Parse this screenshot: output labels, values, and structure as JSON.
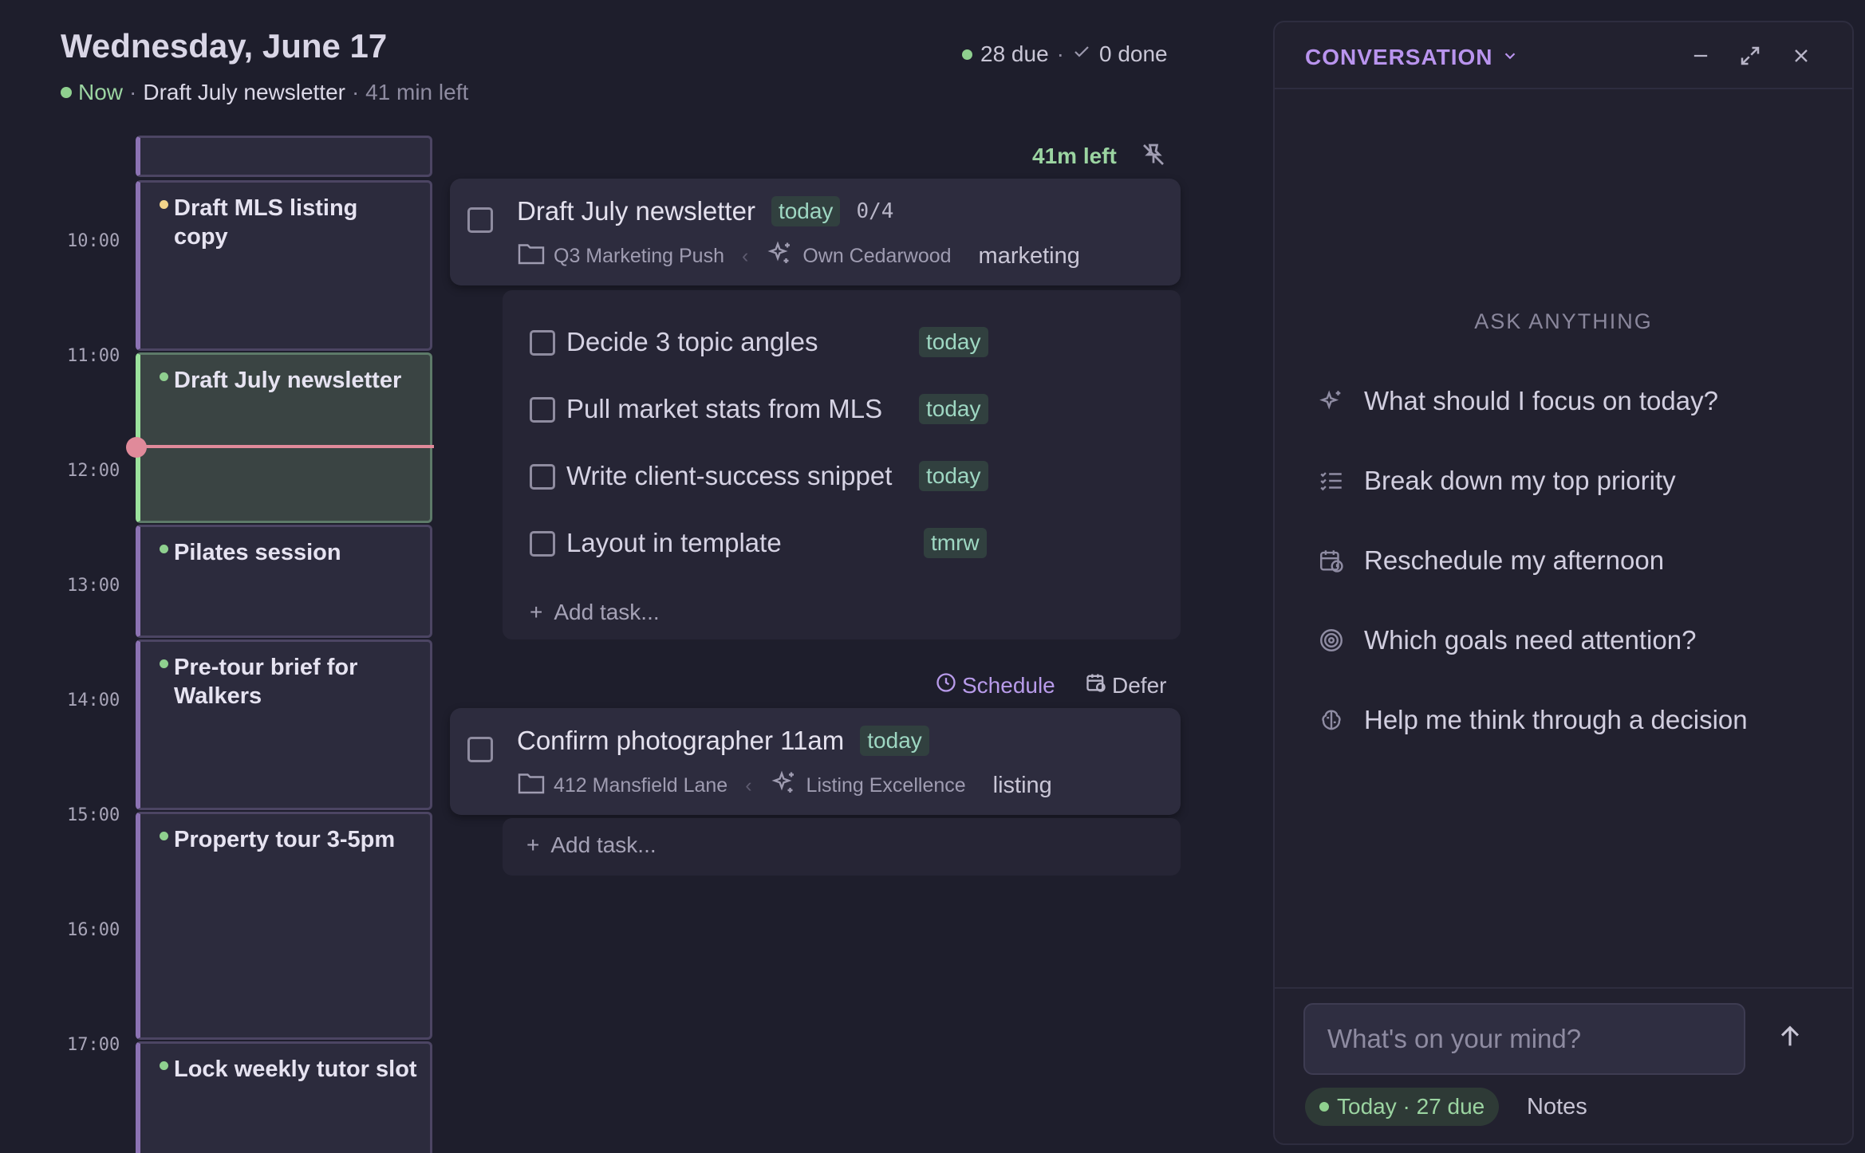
{
  "header": {
    "date": "Wednesday, June 17",
    "now_label": "Now",
    "now_sep": "·",
    "now_task": "Draft July newsletter",
    "now_remaining": "· 41 min left",
    "due": "28 due",
    "stats_sep": "·",
    "done": "0 done"
  },
  "timeline": {
    "hours": [
      "10:00",
      "11:00",
      "12:00",
      "13:00",
      "14:00",
      "15:00",
      "16:00",
      "17:00"
    ],
    "events": [
      {
        "title": "Draft MLS listing copy",
        "dot_color": "#f2d48a"
      },
      {
        "title": "Draft July newsletter",
        "dot_color": "#8fd08f",
        "current": true
      },
      {
        "title": "Pilates session",
        "dot_color": "#8fd08f"
      },
      {
        "title": "Pre-tour brief for Walkers",
        "dot_color": "#8fd08f"
      },
      {
        "title": "Property tour 3-5pm",
        "dot_color": "#8fd08f"
      },
      {
        "title": "Lock weekly tutor slot",
        "dot_color": "#8fd08f"
      }
    ]
  },
  "focus_task": {
    "time_left": "41m left",
    "title": "Draft July newsletter",
    "due_tag": "today",
    "progress": "0/4",
    "project": "Q3 Marketing Push",
    "meta_sep": "‹",
    "goal": "Own Cedarwood",
    "label": "marketing",
    "subtasks": [
      {
        "title": "Decide 3 topic angles",
        "tag": "today"
      },
      {
        "title": "Pull market stats from MLS",
        "tag": "today"
      },
      {
        "title": "Write client-success snippet",
        "tag": "today"
      },
      {
        "title": "Layout in template",
        "tag": "tmrw"
      }
    ],
    "add_task": "Add task..."
  },
  "actions": {
    "schedule": "Schedule",
    "defer": "Defer"
  },
  "second_task": {
    "title": "Confirm photographer 11am",
    "due_tag": "today",
    "project": "412 Mansfield Lane",
    "meta_sep": "‹",
    "goal": "Listing Excellence",
    "label": "listing",
    "add_task": "Add task..."
  },
  "conversation": {
    "title": "CONVERSATION",
    "ask_label": "ASK ANYTHING",
    "prompts": [
      {
        "text": "What should I focus on today?",
        "icon": "sparkle-icon"
      },
      {
        "text": "Break down my top priority",
        "icon": "list-check-icon"
      },
      {
        "text": "Reschedule my afternoon",
        "icon": "calendar-clock-icon"
      },
      {
        "text": "Which goals need attention?",
        "icon": "target-icon"
      },
      {
        "text": "Help me think through a decision",
        "icon": "brain-icon"
      }
    ],
    "input_placeholder": "What's on your mind?",
    "pill": "Today · 27 due",
    "notes": "Notes"
  },
  "colors": {
    "accent": "#b994ee",
    "now_green": "#9bd4a1",
    "now_line": "#e08a9a",
    "background": "#1e1e2c"
  }
}
